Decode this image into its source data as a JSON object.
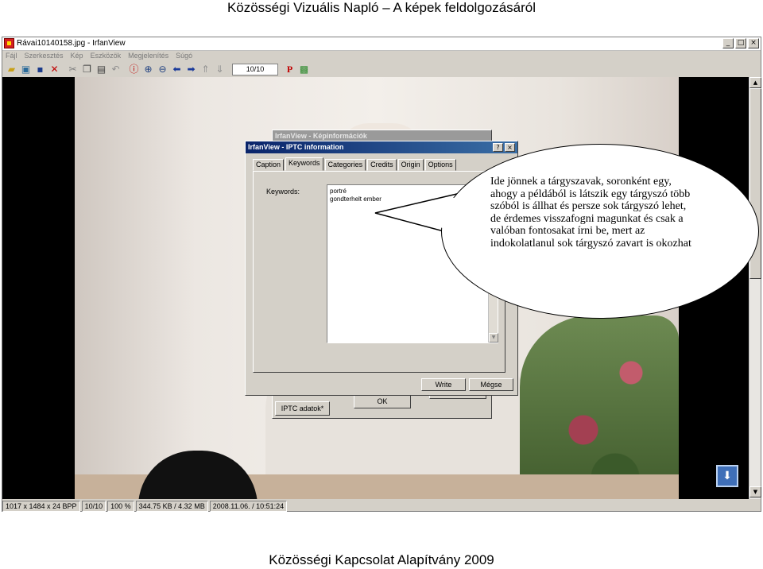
{
  "slide": {
    "title": "Közösségi Vizuális Napló – A képek feldolgozásáról",
    "footer": "Közösségi Kapcsolat Alapítvány 2009"
  },
  "window": {
    "title": "Rávai10140158.jpg - IrfanView",
    "controls": [
      "_",
      "□",
      "×"
    ],
    "menu": [
      "Fájl",
      "Szerkesztés",
      "Kép",
      "Eszközök",
      "Megjelenítés",
      "Súgó"
    ],
    "page_counter": "10/10",
    "status": [
      "1017 x 1484 x 24 BPP",
      "10/10",
      "100 %",
      "344.75 KB / 4.32 MB",
      "2008.11.06. / 10:51:24"
    ]
  },
  "back_dialog": {
    "title": "IrfanView - Képinformációk",
    "iptc_button": "IPTC adatok*",
    "ok_button": "OK"
  },
  "iptc_dialog": {
    "title": "IrfanView - IPTC information",
    "close": "×",
    "help": "?",
    "tabs": [
      "Caption",
      "Keywords",
      "Categories",
      "Credits",
      "Origin",
      "Options"
    ],
    "active_tab": "Keywords",
    "keywords_label": "Keywords:",
    "keywords": [
      "portré",
      "gondterhelt ember"
    ],
    "write_button": "Write",
    "cancel_button": "Mégse"
  },
  "callout": {
    "text": "Ide jönnek a tárgyszavak, soronként egy, ahogy a példából is látszik egy tárgyszó több szóból is állhat és persze sok tárgyszó lehet, de érdemes visszafogni magunkat és csak a valóban fontosakat írni be, mert az indokolatlanul sok tárgyszó zavart is okozhat"
  },
  "colors": {
    "dialog_titlebar": "#0a246a",
    "window_face": "#d4d0c8",
    "viewport_bg": "#000000"
  }
}
